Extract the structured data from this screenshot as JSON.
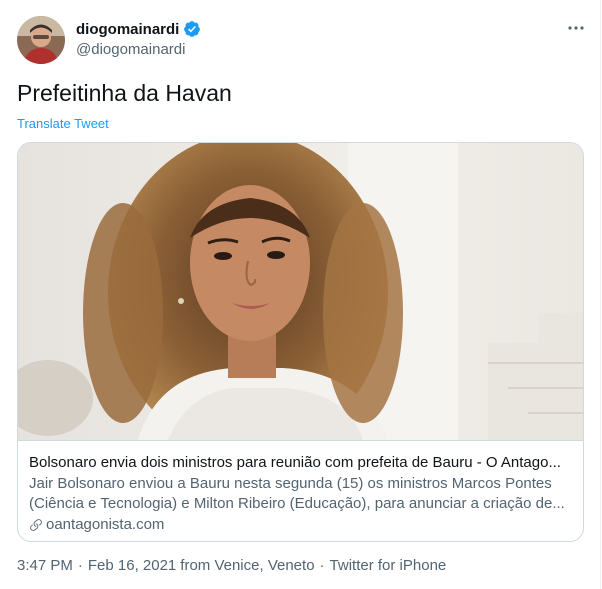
{
  "author": {
    "display_name": "diogomainardi",
    "handle": "@diogomainardi",
    "verified": true
  },
  "tweet": {
    "text": "Prefeitinha da Havan",
    "translate_label": "Translate Tweet"
  },
  "card": {
    "title": "Bolsonaro envia dois ministros para reunião com prefeita de Bauru - O Antago...",
    "description": "Jair Bolsonaro enviou a Bauru nesta segunda (15) os ministros Marcos Pontes (Ciência e Tecnologia) e Milton Ribeiro (Educação), para anunciar a criação de...",
    "domain": "oantagonista.com"
  },
  "meta": {
    "time": "3:47 PM",
    "date": "Feb 16, 2021",
    "location": "from Venice, Veneto",
    "separator": "·",
    "source": "Twitter for iPhone"
  },
  "icons": {
    "verified": "verified-badge-icon",
    "more": "more-dots-icon",
    "link": "link-icon"
  },
  "colors": {
    "accent": "#1d9bf0",
    "text_primary": "#0f1419",
    "text_secondary": "#536471",
    "border": "#cfd9de"
  }
}
